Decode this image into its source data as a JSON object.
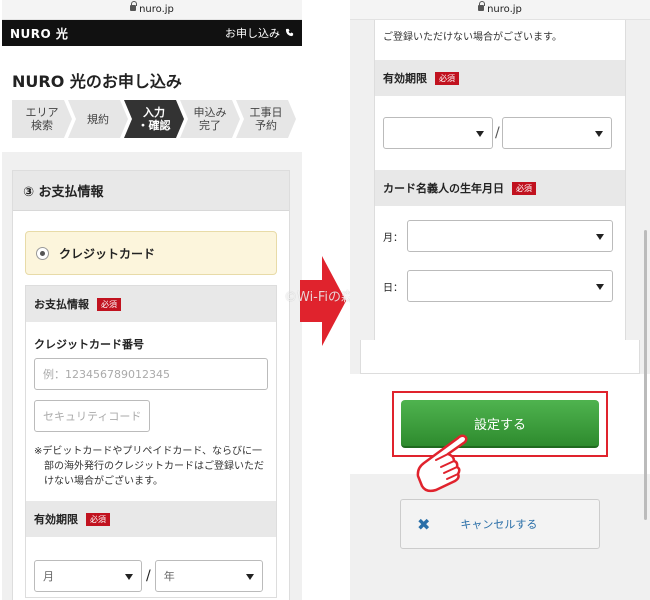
{
  "left": {
    "url": "nuro.jp",
    "logo": "NURO 光",
    "apply_link": "お申し込み",
    "page_title": "NURO 光のお申し込み",
    "steps": [
      {
        "l1": "エリア",
        "l2": "検索"
      },
      {
        "l1": "規約",
        "l2": ""
      },
      {
        "l1": "入力",
        "l2": "・確認"
      },
      {
        "l1": "申込み",
        "l2": "完了"
      },
      {
        "l1": "工事日",
        "l2": "予約"
      }
    ],
    "section_title": "③ お支払情報",
    "payment_option": "クレジットカード",
    "subsection_title": "お支払情報",
    "required": "必須",
    "card_number_label": "クレジットカード番号",
    "card_number_placeholder": "例：123456789012345",
    "security_code_placeholder": "セキュリティコード",
    "note": "※デビットカードやプリペイドカード、ならびに一部の海外発行のクレジットカードはご登録いただけない場合がございます。",
    "expiry_label": "有効期限",
    "expiry_month": "月",
    "expiry_sep": "/",
    "expiry_year": "年"
  },
  "watermark": "©Wi-Fiの森",
  "right": {
    "url": "nuro.jp",
    "note_tail": "ご登録いただけない場合がございます。",
    "expiry_label": "有効期限",
    "required": "必須",
    "expiry_sep": "/",
    "dob_label": "カード名義人の生年月日",
    "dob_month_label": "月：",
    "dob_day_label": "日：",
    "submit": "設定する",
    "cancel": "キャンセルする"
  },
  "colors": {
    "arrow": "#e0232d",
    "required_badge": "#c1121f",
    "submit_green": "#3aa23a",
    "highlight_frame": "#e0232d"
  }
}
